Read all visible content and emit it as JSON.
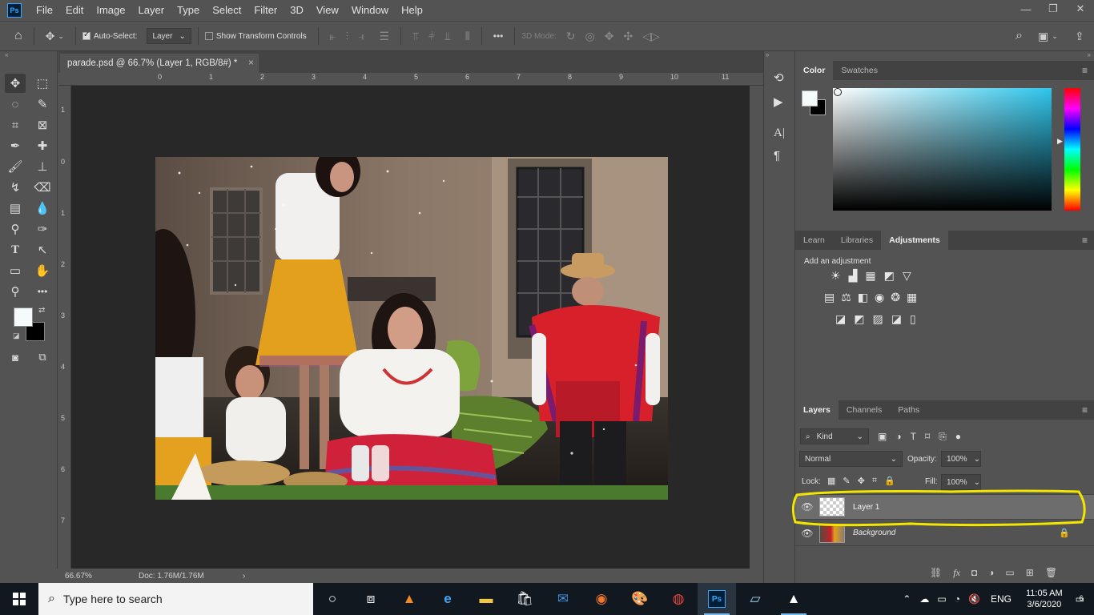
{
  "menubar": {
    "logo": "Ps",
    "items": [
      "File",
      "Edit",
      "Image",
      "Layer",
      "Type",
      "Select",
      "Filter",
      "3D",
      "View",
      "Window",
      "Help"
    ],
    "win_min": "—",
    "win_restore": "❐",
    "win_close": "✕"
  },
  "options": {
    "auto_select_label": "Auto-Select:",
    "auto_select_target": "Layer",
    "show_transform_label": "Show Transform Controls",
    "more": "•••",
    "mode_3d": "3D Mode:"
  },
  "document": {
    "tab_title": "parade.psd @ 66.7% (Layer 1, RGB/8#) *",
    "tab_close": "×",
    "ruler_h": [
      "0",
      "1",
      "2",
      "3",
      "4",
      "5",
      "6",
      "7",
      "8",
      "9",
      "10",
      "11"
    ],
    "ruler_v": [
      "1",
      "0",
      "1",
      "2",
      "3",
      "4",
      "5",
      "6",
      "7"
    ],
    "zoom": "66.67%",
    "doc_size": "Doc: 1.76M/1.76M",
    "status_arrow": "›"
  },
  "color_panel": {
    "tabs": [
      "Color",
      "Swatches"
    ],
    "active_tab": "Color",
    "foreground": "#f5fbfb",
    "background": "#000000",
    "hue": "#2ec6ec"
  },
  "adjust_panel": {
    "tabs": [
      "Learn",
      "Libraries",
      "Adjustments"
    ],
    "active_tab": "Adjustments",
    "heading": "Add an adjustment",
    "row1": [
      "☀",
      "▟",
      "▦",
      "◩",
      "▽"
    ],
    "row2": [
      "▤",
      "⚖",
      "◧",
      "◉",
      "❂",
      "▦"
    ],
    "row3": [
      "◪",
      "◩",
      "▨",
      "◪",
      "▯"
    ]
  },
  "layers_panel": {
    "tabs": [
      "Layers",
      "Channels",
      "Paths"
    ],
    "active_tab": "Layers",
    "filter_kind": "Kind",
    "blend_mode": "Normal",
    "opacity_label": "Opacity:",
    "opacity_value": "100%",
    "lock_label": "Lock:",
    "fill_label": "Fill:",
    "fill_value": "100%",
    "layers": [
      {
        "name": "Layer 1",
        "selected": true
      },
      {
        "name": "Background",
        "selected": false,
        "locked": true
      }
    ],
    "footer_icons": [
      "⛓",
      "fx",
      "◘",
      "◑",
      "▭",
      "⊞",
      "🗑"
    ],
    "highlight_color": "#f2e600"
  },
  "taskbar": {
    "search_placeholder": "Type here to search",
    "lang": "ENG",
    "time": "11:05 AM",
    "date": "3/6/2020",
    "notif_count": "6"
  }
}
